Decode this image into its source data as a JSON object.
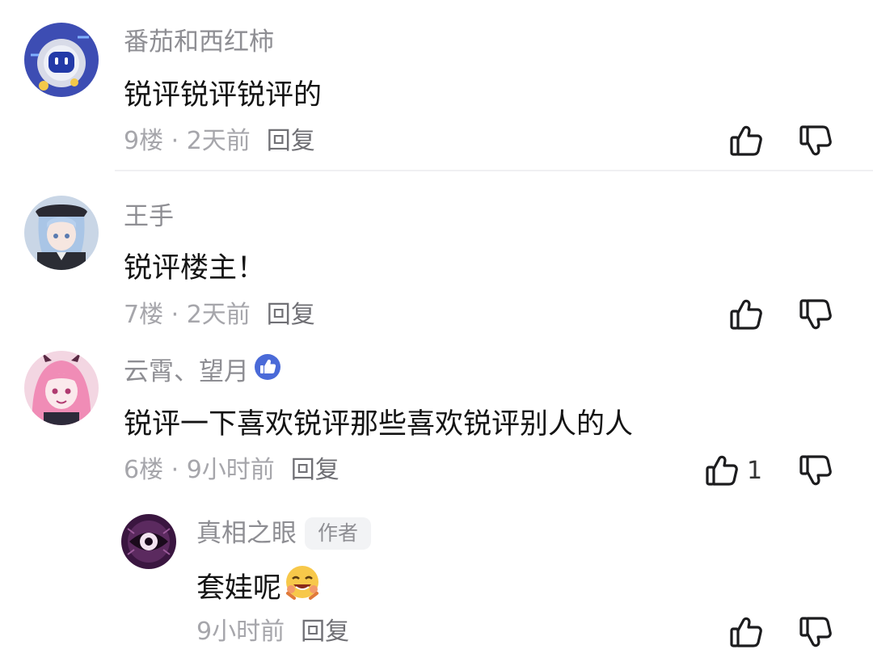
{
  "comments": [
    {
      "username": "番茄和西红柿",
      "content": "锐评锐评锐评的",
      "floor": "9楼",
      "time": "2天前",
      "reply": "回复",
      "avatar_icon": "robot-avatar"
    },
    {
      "username": "王手",
      "content": "锐评楼主！",
      "floor": "7楼",
      "time": "2天前",
      "reply": "回复",
      "avatar_icon": "anime-girl-avatar"
    },
    {
      "username": "云霄、望月",
      "content": "锐评一下喜欢锐评那些喜欢锐评别人的人",
      "floor": "6楼",
      "time": "9小时前",
      "reply": "回复",
      "like_count": "1",
      "avatar_icon": "pink-hair-avatar",
      "badge_icon": "thumbs-up-badge-icon"
    }
  ],
  "reply_comment": {
    "username": "真相之眼",
    "author_tag": "作者",
    "content": "套娃呢",
    "time": "9小时前",
    "reply": "回复",
    "emoji_icon": "laughing-emoji",
    "avatar_icon": "eye-avatar"
  },
  "separator": " · ",
  "colors": {
    "username": "#8e8e93",
    "meta": "#a6a6ab",
    "badge_blue": "#4a6ad8",
    "divider": "#f0f0f2"
  }
}
